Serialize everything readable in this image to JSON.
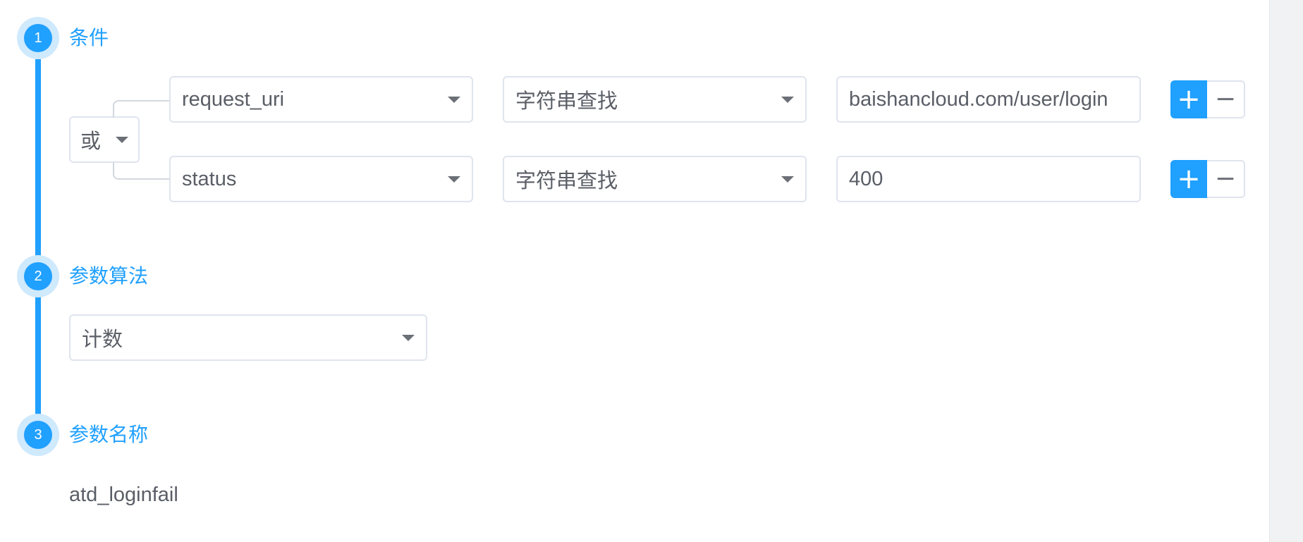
{
  "steps": [
    {
      "number": "1",
      "title": "条件"
    },
    {
      "number": "2",
      "title": "参数算法"
    },
    {
      "number": "3",
      "title": "参数名称"
    }
  ],
  "condition": {
    "logic_operator": "或",
    "rows": [
      {
        "field": "request_uri",
        "operator": "字符串查找",
        "value": "baishancloud.com/user/login"
      },
      {
        "field": "status",
        "operator": "字符串查找",
        "value": "400"
      }
    ],
    "add_icon": "plus-icon",
    "remove_icon": "minus-icon"
  },
  "algorithm": {
    "selected": "计数"
  },
  "parameter": {
    "name": "atd_loginfail"
  },
  "colors": {
    "accent": "#20a0ff",
    "accent_light": "#cfe9fd",
    "border": "#dfe4ed",
    "text": "#5a5e66"
  }
}
